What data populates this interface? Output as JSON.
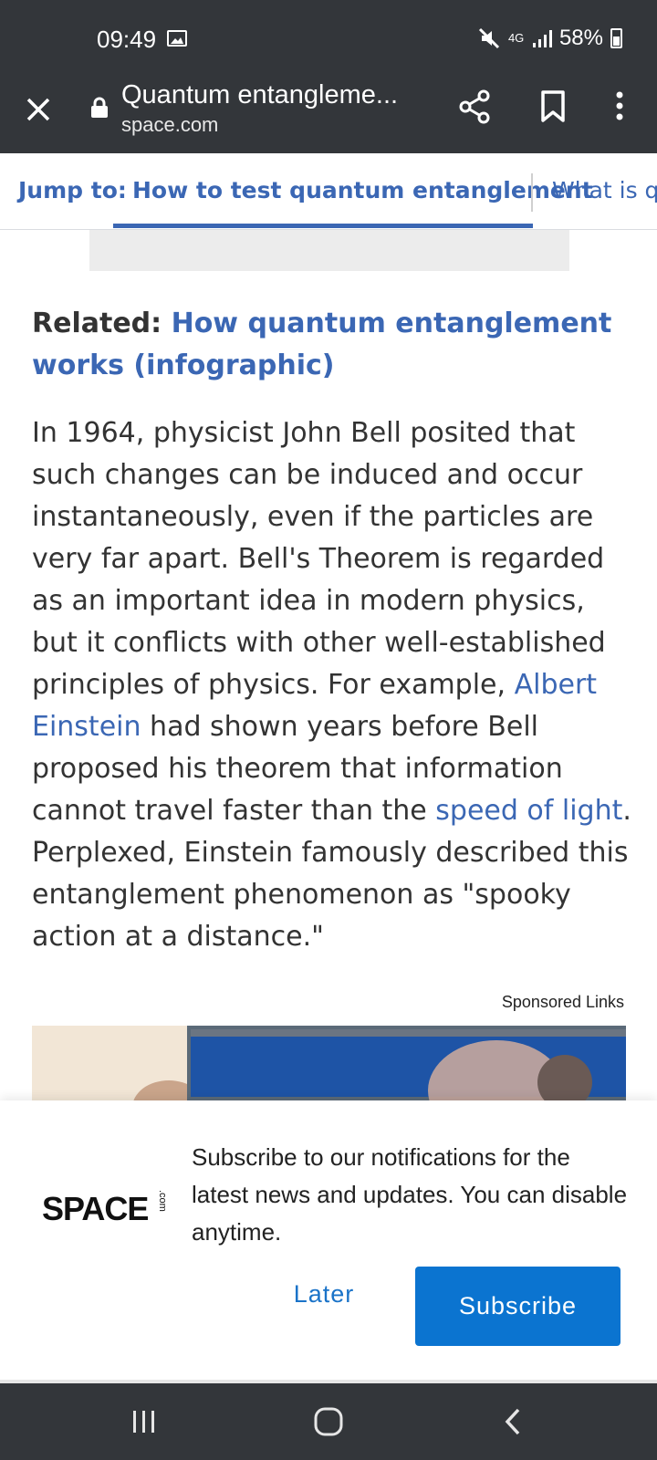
{
  "status_bar": {
    "time": "09:49",
    "network": "4G",
    "battery": "58%"
  },
  "toolbar": {
    "page_title": "Quantum entangleme...",
    "domain": "space.com"
  },
  "jump_bar": {
    "label": "Jump to:",
    "tabs": [
      {
        "label": "How to test quantum entanglement",
        "active": true
      },
      {
        "label": "What is qu",
        "active": false
      }
    ]
  },
  "article": {
    "related_label": "Related:",
    "related_link": "How quantum entanglement works (infographic)",
    "p_1": "In 1964, physicist John Bell posited that such changes can be induced and occur instantaneously, even if the particles are very far apart. Bell's Theorem is regarded as an important idea in modern physics, but it conflicts with other well-established principles of physics. For example, ",
    "link_einstein": "Albert Einstein",
    "p_2": " had shown years before Bell proposed his theorem that information cannot travel faster than the ",
    "link_light": "speed of light",
    "p_3": ". Perplexed, Einstein famously described this entanglement phenomenon as \"spooky action at a distance.\"",
    "sponsored_label": "Sponsored Links"
  },
  "notification": {
    "logo_text": "SPACE",
    "logo_suffix": ".com",
    "message": "Subscribe to our notifications for the latest news and updates. You can disable anytime.",
    "later_label": "Later",
    "subscribe_label": "Subscribe"
  },
  "colors": {
    "link": "#3b67b4",
    "chrome": "#33363a",
    "subscribe": "#0b74d0"
  },
  "icons": [
    "gallery-icon",
    "mute-icon",
    "signal-icon",
    "battery-icon",
    "close-icon",
    "lock-icon",
    "share-icon",
    "bookmark-icon",
    "more-vert-icon",
    "recent-apps-icon",
    "home-icon",
    "back-icon"
  ]
}
